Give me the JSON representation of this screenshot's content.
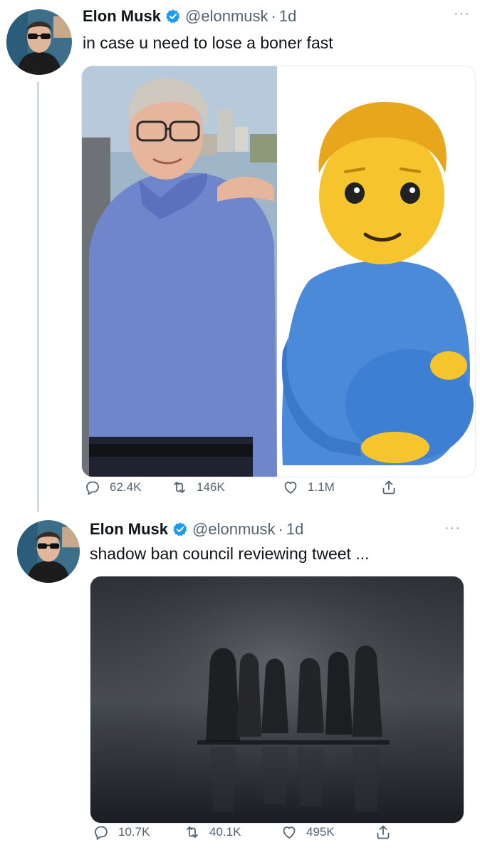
{
  "tweets": [
    {
      "author_name": "Elon Musk",
      "handle": "@elonmusk",
      "separator": "·",
      "time": "1d",
      "text": "in case u need to lose a boner fast",
      "more": "···",
      "stats": {
        "replies": "62.4K",
        "retweets": "146K",
        "likes": "1.1M"
      }
    },
    {
      "author_name": "Elon Musk",
      "handle": "@elonmusk",
      "separator": "·",
      "time": "1d",
      "text": "shadow ban council reviewing tweet ...",
      "more": "···",
      "stats": {
        "replies": "10.7K",
        "retweets": "40.1K",
        "likes": "495K"
      }
    }
  ],
  "icons": {
    "verified": "verified-badge-icon",
    "reply": "reply-icon",
    "retweet": "retweet-icon",
    "like": "heart-icon",
    "share": "share-icon",
    "more": "more-icon"
  },
  "colors": {
    "verified": "#1d9bf0",
    "secondary_text": "#536471",
    "thread_line": "#cfd9de"
  }
}
